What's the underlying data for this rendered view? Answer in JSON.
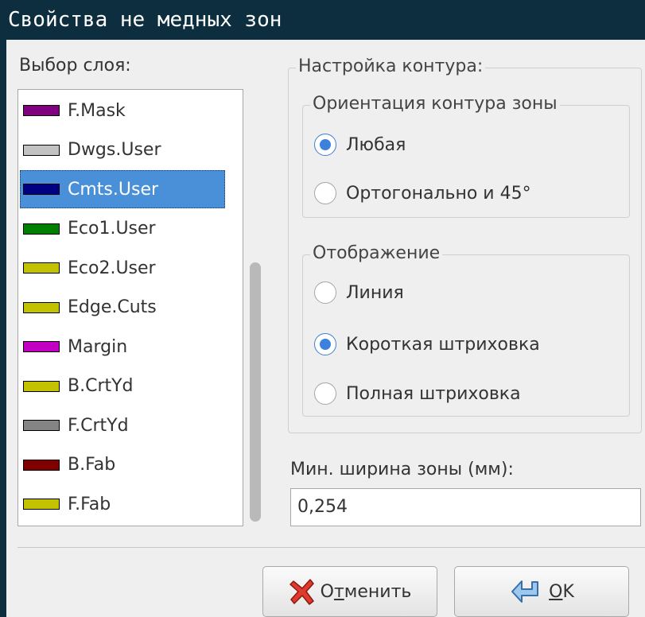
{
  "window": {
    "title": "Свойства не медных зон"
  },
  "layers": {
    "label": "Выбор слоя:",
    "items": [
      {
        "name": "F.Mask",
        "color": "#800080",
        "selected": false
      },
      {
        "name": "Dwgs.User",
        "color": "#c2c2c2",
        "selected": false
      },
      {
        "name": "Cmts.User",
        "color": "#000080",
        "selected": true
      },
      {
        "name": "Eco1.User",
        "color": "#008000",
        "selected": false
      },
      {
        "name": "Eco2.User",
        "color": "#c2c200",
        "selected": false
      },
      {
        "name": "Edge.Cuts",
        "color": "#c2c200",
        "selected": false
      },
      {
        "name": "Margin",
        "color": "#c200c2",
        "selected": false
      },
      {
        "name": "B.CrtYd",
        "color": "#c2c200",
        "selected": false
      },
      {
        "name": "F.CrtYd",
        "color": "#848484",
        "selected": false
      },
      {
        "name": "B.Fab",
        "color": "#800000",
        "selected": false
      },
      {
        "name": "F.Fab",
        "color": "#c2c200",
        "selected": false
      }
    ]
  },
  "outline": {
    "title": "Настройка контура:",
    "orientation": {
      "title": "Ориентация контура зоны",
      "options": [
        "Любая",
        "Ортогонально и 45°"
      ],
      "selected": 0
    },
    "display": {
      "title": "Отображение",
      "options": [
        "Линия",
        "Короткая штриховка",
        "Полная штриховка"
      ],
      "selected": 1
    }
  },
  "min_width": {
    "label": "Мин. ширина зоны (мм):",
    "value": "0,254"
  },
  "buttons": {
    "cancel": {
      "pre": "О",
      "mnemonic": "т",
      "post": "менить"
    },
    "ok": {
      "mnemonic": "O",
      "post": "K"
    }
  }
}
